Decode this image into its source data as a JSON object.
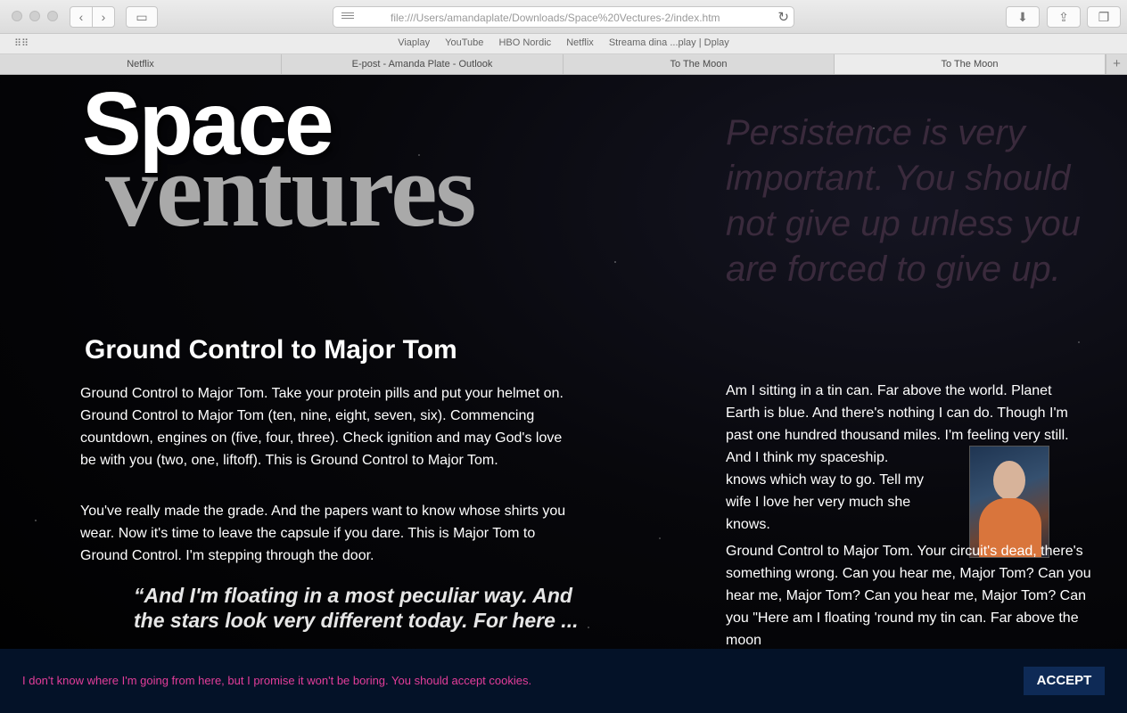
{
  "browser": {
    "url": "file:///Users/amandaplate/Downloads/Space%20Vectures-2/index.htm",
    "favorites": [
      "Viaplay",
      "YouTube",
      "HBO Nordic",
      "Netflix",
      "Streama dina ...play | Dplay"
    ],
    "tabs": [
      {
        "label": "Netflix"
      },
      {
        "label": "E-post - Amanda Plate - Outlook"
      },
      {
        "label": "To The Moon"
      },
      {
        "label": "To The Moon"
      }
    ],
    "add_tab": "+"
  },
  "page": {
    "logo_top": "Space",
    "logo_bottom": "ventures",
    "quote": "Persistence is very important. You should not give up unless you are forced to give up.",
    "heading": "Ground Control to Major Tom",
    "para1": "Ground Control to Major Tom. Take your protein pills and put your helmet on. Ground Control to Major Tom (ten, nine, eight, seven, six). Commencing countdown, engines on (five, four, three). Check ignition and may God's love be with you (two, one, liftoff). This is Ground Control to Major Tom.",
    "para2": "You've really made the grade. And the papers want to know whose shirts you wear. Now it's time to leave the capsule if you dare. This is Major Tom to Ground Control. I'm stepping through the door.",
    "pull_quote": "“And I'm floating in a most peculiar way. And the stars look very different today. For here ...",
    "right_para1": "Am I sitting in a tin can. Far above the world. Planet Earth is blue. And there's nothing I can do. Though I'm past one hundred thousand miles. I'm feeling very still. And I think my spaceship.",
    "right_para1b": "knows which way to go. Tell my wife I love her very much she knows.",
    "right_para2": "Ground Control to Major Tom. Your circuit's dead, there's something wrong. Can you hear me, Major Tom? Can you hear me, Major Tom? Can you hear me, Major Tom? Can you \"Here am I floating 'round my tin can. Far above the moon"
  },
  "cookie": {
    "text": "I don't know where I'm going from here, but I promise it won't be boring. You should accept cookies.",
    "accept_label": "ACCEPT"
  },
  "colors": {
    "quote": "#3a2a3c",
    "cookie_text": "#e43d9a",
    "cookie_bg": "#041228",
    "accept_bg": "#0e2a56"
  }
}
